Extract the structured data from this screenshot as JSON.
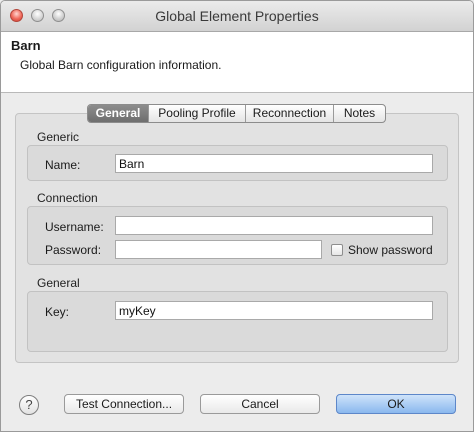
{
  "window": {
    "title": "Global Element Properties"
  },
  "header": {
    "title": "Barn",
    "description": "Global Barn configuration information."
  },
  "tabs": [
    {
      "label": "General",
      "active": true
    },
    {
      "label": "Pooling Profile",
      "active": false
    },
    {
      "label": "Reconnection",
      "active": false
    },
    {
      "label": "Notes",
      "active": false
    }
  ],
  "generic": {
    "label": "Generic",
    "name_label": "Name:",
    "name_value": "Barn"
  },
  "connection": {
    "label": "Connection",
    "username_label": "Username:",
    "username_value": "",
    "password_label": "Password:",
    "password_value": "",
    "show_password_label": "Show password",
    "show_password_checked": false
  },
  "general": {
    "label": "General",
    "key_label": "Key:",
    "key_value": "myKey"
  },
  "footer": {
    "help_glyph": "?",
    "test_label": "Test Connection...",
    "cancel_label": "Cancel",
    "ok_label": "OK"
  },
  "icons": {
    "help": "help-icon"
  },
  "colors": {
    "accent": "#8ab8ee",
    "active_tab": "#7a7a7a"
  }
}
